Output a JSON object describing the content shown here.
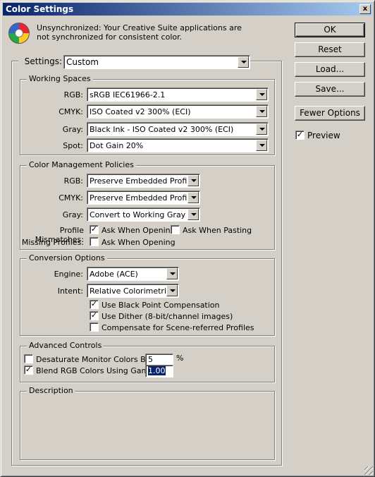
{
  "window": {
    "title": "Color Settings",
    "close_glyph": "x"
  },
  "warning": {
    "icon": "color-wheel-icon",
    "text": "Unsynchronized: Your Creative Suite applications are not synchronized for consistent color."
  },
  "buttons": {
    "ok": "OK",
    "reset": "Reset",
    "load": "Load...",
    "save": "Save...",
    "fewer_options": "Fewer Options"
  },
  "preview": {
    "label": "Preview",
    "checked": true
  },
  "settings": {
    "label": "Settings:",
    "value": "Custom"
  },
  "working_spaces": {
    "title": "Working Spaces",
    "rgb": {
      "label": "RGB:",
      "value": "sRGB IEC61966-2.1"
    },
    "cmyk": {
      "label": "CMYK:",
      "value": "ISO Coated v2 300% (ECI)"
    },
    "gray": {
      "label": "Gray:",
      "value": "Black Ink - ISO Coated v2 300% (ECI)"
    },
    "spot": {
      "label": "Spot:",
      "value": "Dot Gain 20%"
    }
  },
  "cmp": {
    "title": "Color Management Policies",
    "rgb": {
      "label": "RGB:",
      "value": "Preserve Embedded Profiles"
    },
    "cmyk": {
      "label": "CMYK:",
      "value": "Preserve Embedded Profiles"
    },
    "gray": {
      "label": "Gray:",
      "value": "Convert to Working Gray"
    },
    "mismatch_label": "Profile Mismatches:",
    "ask_opening": {
      "label": "Ask When Opening",
      "checked": true
    },
    "ask_pasting": {
      "label": "Ask When Pasting",
      "checked": false
    },
    "missing_label": "Missing Profiles:",
    "missing_ask_opening": {
      "label": "Ask When Opening",
      "checked": false
    }
  },
  "conversion": {
    "title": "Conversion Options",
    "engine": {
      "label": "Engine:",
      "value": "Adobe (ACE)"
    },
    "intent": {
      "label": "Intent:",
      "value": "Relative Colorimetric"
    },
    "black_point": {
      "label": "Use Black Point Compensation",
      "checked": true
    },
    "dither": {
      "label": "Use Dither (8-bit/channel images)",
      "checked": true
    },
    "scene_referred": {
      "label": "Compensate for Scene-referred Profiles",
      "checked": false
    }
  },
  "advanced": {
    "title": "Advanced Controls",
    "desaturate": {
      "label": "Desaturate Monitor Colors By:",
      "checked": false,
      "value": "5",
      "unit": "%"
    },
    "blend": {
      "label": "Blend RGB Colors Using Gamma:",
      "checked": true,
      "value": "1.00"
    }
  },
  "description": {
    "title": "Description"
  }
}
